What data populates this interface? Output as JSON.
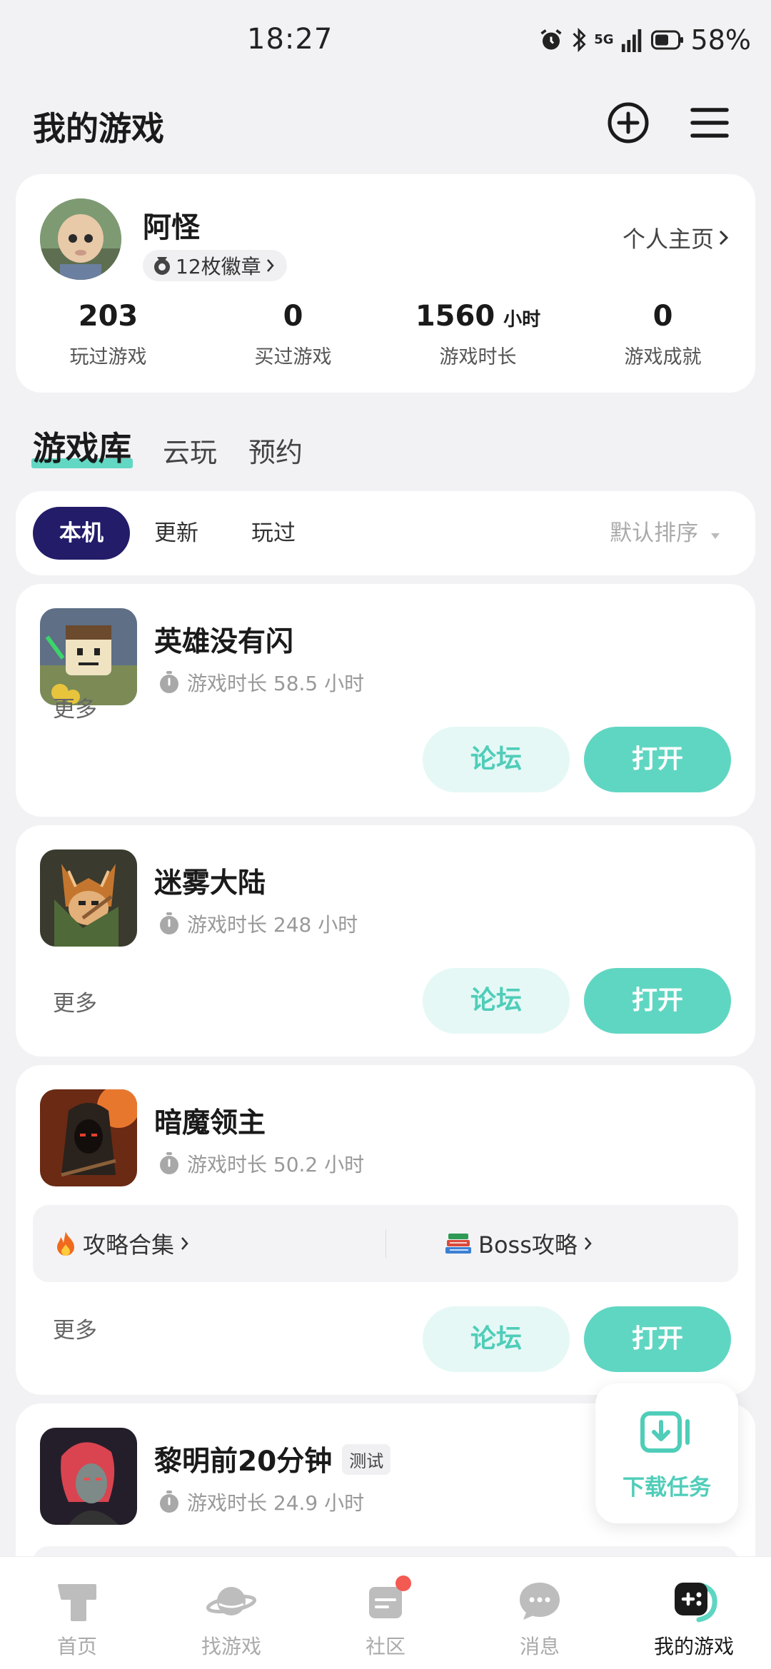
{
  "status_bar": {
    "time": "18:27",
    "network": "5G",
    "battery": "58%"
  },
  "header": {
    "title": "我的游戏"
  },
  "profile": {
    "name": "阿怪",
    "badges": "12枚徽章",
    "homepage_link": "个人主页",
    "stats": [
      {
        "value": "203",
        "unit": "",
        "label": "玩过游戏"
      },
      {
        "value": "0",
        "unit": "",
        "label": "买过游戏"
      },
      {
        "value": "1560",
        "unit": "小时",
        "label": "游戏时长"
      },
      {
        "value": "0",
        "unit": "",
        "label": "游戏成就"
      }
    ]
  },
  "library_tabs": [
    "游戏库",
    "云玩",
    "预约"
  ],
  "filters": {
    "chips": [
      "本机",
      "更新",
      "玩过"
    ],
    "sort": "默认排序"
  },
  "games": [
    {
      "name": "英雄没有闪",
      "time": "游戏时长 58.5 小时",
      "more": "更多",
      "forum": "论坛",
      "open": "打开"
    },
    {
      "name": "迷雾大陆",
      "time": "游戏时长 248 小时",
      "more": "更多",
      "forum": "论坛",
      "open": "打开"
    },
    {
      "name": "暗魔领主",
      "time": "游戏时长 50.2 小时",
      "guides": [
        "攻略合集",
        "Boss攻略"
      ],
      "more": "更多",
      "forum": "论坛",
      "open": "打开"
    },
    {
      "name": "黎明前20分钟",
      "badge": "测试",
      "time": "游戏时长 24.9 小时"
    }
  ],
  "fab": {
    "label": "下载任务",
    "icon": "download-icon"
  },
  "tabbar": [
    {
      "label": "首页",
      "icon": "home-icon"
    },
    {
      "label": "找游戏",
      "icon": "planet-icon"
    },
    {
      "label": "社区",
      "icon": "community-icon"
    },
    {
      "label": "消息",
      "icon": "message-icon"
    },
    {
      "label": "我的游戏",
      "icon": "gamepad-icon"
    }
  ],
  "colors": {
    "accent": "#5fd6c2",
    "forum_bg": "#e5f8f5",
    "active_chip": "#231c69",
    "dot": "#f25a52"
  }
}
